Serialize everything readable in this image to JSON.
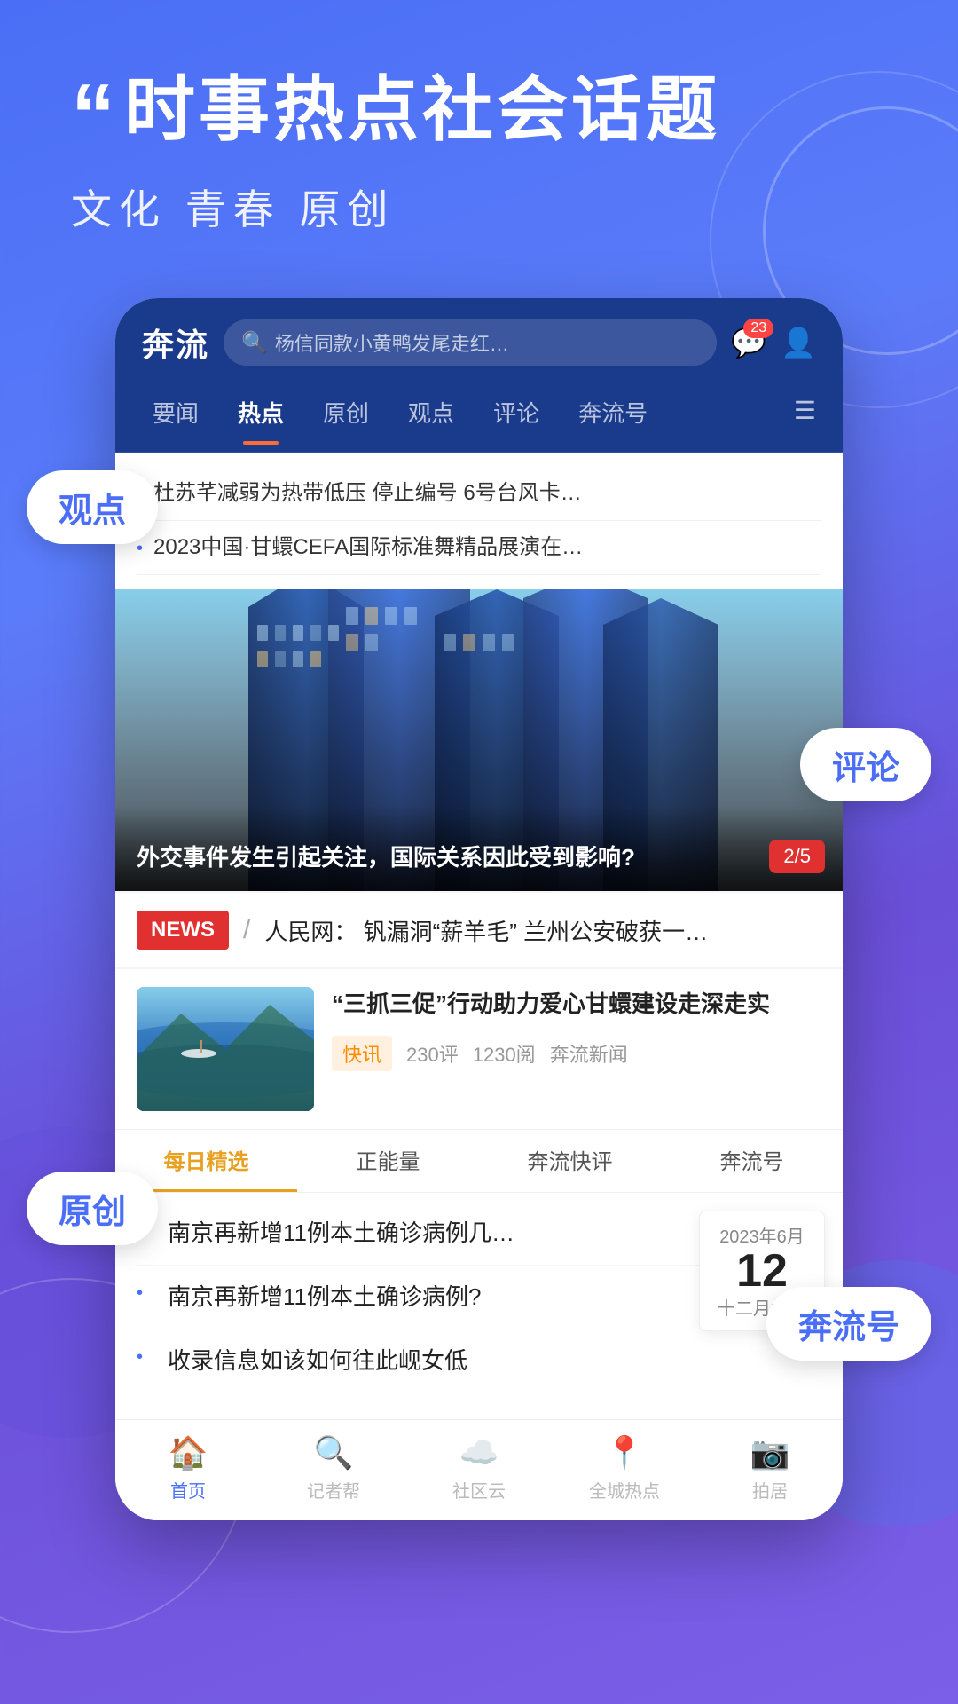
{
  "page": {
    "background": "#4a6ef5"
  },
  "header": {
    "quote_mark": "“",
    "headline": "时事热点社会话题",
    "subtitle": "文化 青春 原创"
  },
  "float_labels": {
    "guandian": "观点",
    "pinglun": "评论",
    "yuanchuang": "原创",
    "benliu": "奔流号"
  },
  "app": {
    "logo": "奔流",
    "search_placeholder": "杨信同款小黄鸭发尾走红…",
    "notif_count": "23",
    "nav_tabs": [
      {
        "label": "要闻",
        "active": false
      },
      {
        "label": "热点",
        "active": true
      },
      {
        "label": "原创",
        "active": false
      },
      {
        "label": "观点",
        "active": false
      },
      {
        "label": "评论",
        "active": false
      },
      {
        "label": "奔流号",
        "active": false
      }
    ]
  },
  "news_list": [
    {
      "text": "杜苏芊减弱为热带低压 停止编号 6号台风卡…"
    },
    {
      "text": "2023中国·甘蠉CEFA国际标准舞精品展演在…"
    }
  ],
  "featured": {
    "caption": "外交事件发生引起关注，国际关系因此受到影响?",
    "counter": "2/5"
  },
  "ticker": {
    "badge": "NEWS",
    "divider": "/",
    "text": "人民网： 钒漏洞“薪羊毛” 兰州公安破获一…"
  },
  "article": {
    "title": "“三抓三促”行动助力爱心甘蠉建设走深走实",
    "tag": "快讯",
    "comments": "230评",
    "reads": "1230阅",
    "source": "奔流新闻"
  },
  "daily_tabs": [
    {
      "label": "每日精选",
      "active": true
    },
    {
      "label": "正能量",
      "active": false
    },
    {
      "label": "奔流快评",
      "active": false
    },
    {
      "label": "奔流号",
      "active": false
    }
  ],
  "bottom_news": [
    {
      "text": "南京再新增11例本土确诊病例几…"
    },
    {
      "text": "南京再新增11例本土确诊病例?"
    },
    {
      "text": "收录信息如该如何往此岘女低"
    }
  ],
  "date": {
    "year": "2023年6月",
    "day": "12",
    "lunar": "十二月廿五"
  },
  "bottom_nav": [
    {
      "label": "首页",
      "active": true,
      "icon": "🏠"
    },
    {
      "label": "记者帮",
      "active": false,
      "icon": "🔍"
    },
    {
      "label": "社区云",
      "active": false,
      "icon": "☁️"
    },
    {
      "label": "全城热点",
      "active": false,
      "icon": "📍"
    },
    {
      "label": "拍居",
      "active": false,
      "icon": "📷"
    }
  ]
}
